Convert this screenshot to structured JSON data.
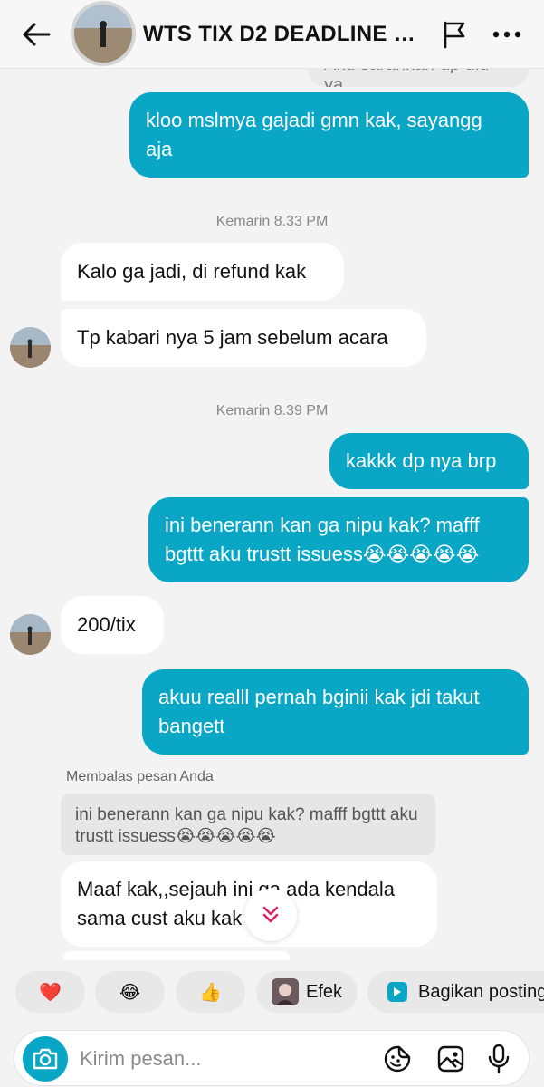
{
  "header": {
    "title": "WTS TIX D2 DEADLINE L..."
  },
  "colors": {
    "accent": "#0aa6c6",
    "incoming_bubble": "#ffffff",
    "background": "#f3f3f3"
  },
  "messages": {
    "cut_top": "Aku sarankan dp dlu ya",
    "out1": "kloo mslmya gajadi gmn kak, sayangg aja",
    "ts1": "Kemarin 8.33 PM",
    "in1": "Kalo ga jadi, di refund kak",
    "in2": "Tp kabari nya 5 jam sebelum acara",
    "ts2": "Kemarin 8.39 PM",
    "out2": "kakkk dp nya brp",
    "out3": "ini benerann kan ga nipu kak? mafff bgttt aku trustt issuess😭😭😭😭😭",
    "in3": "200/tix",
    "out4": "akuu realll pernah bginii kak jdi takut bangett",
    "reply_label": "Membalas pesan Anda",
    "reply_quote": "ini benerann kan ga nipu kak? mafff bgttt aku trustt issuess😭😭😭😭😭",
    "in4": "Maaf kak,,sejauh ini ga ada kendala sama cust aku kak"
  },
  "quick_replies": {
    "heart": "❤️",
    "laugh": "😂",
    "thumbs": "👍",
    "effects": "Efek",
    "share": "Bagikan postingan"
  },
  "composer": {
    "placeholder": "Kirim pesan..."
  },
  "icons": [
    "back-arrow-icon",
    "flag-icon",
    "more-icon",
    "chevron-double-down-icon",
    "camera-icon",
    "sticker-icon",
    "gallery-icon",
    "microphone-icon",
    "play-icon"
  ]
}
